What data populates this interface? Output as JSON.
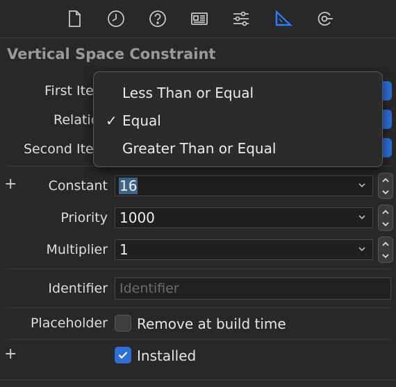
{
  "toolbar": {
    "icons": [
      "file-icon",
      "history-icon",
      "help-icon",
      "identity-icon",
      "attributes-icon",
      "size-ruler-icon",
      "connections-icon"
    ],
    "accent": "#2e7cf6"
  },
  "section": {
    "title": "Vertical Space Constraint"
  },
  "labels": {
    "first_item": "First Ite",
    "relation": "Relatio",
    "second_item": "Second Ite",
    "constant": "Constant",
    "priority": "Priority",
    "multiplier": "Multiplier",
    "identifier": "Identifier",
    "placeholder": "Placeholder"
  },
  "fields": {
    "constant": "16",
    "priority": "1000",
    "multiplier": "1",
    "identifier_placeholder": "Identifier"
  },
  "checkboxes": {
    "remove_at_build": {
      "label": "Remove at build time",
      "checked": false
    },
    "installed": {
      "label": "Installed",
      "checked": true
    }
  },
  "plus_symbol": "+",
  "relation_menu": {
    "items": [
      {
        "label": "Less Than or Equal",
        "checked": false
      },
      {
        "label": "Equal",
        "checked": true
      },
      {
        "label": "Greater Than or Equal",
        "checked": false
      }
    ],
    "check_mark": "✓"
  }
}
